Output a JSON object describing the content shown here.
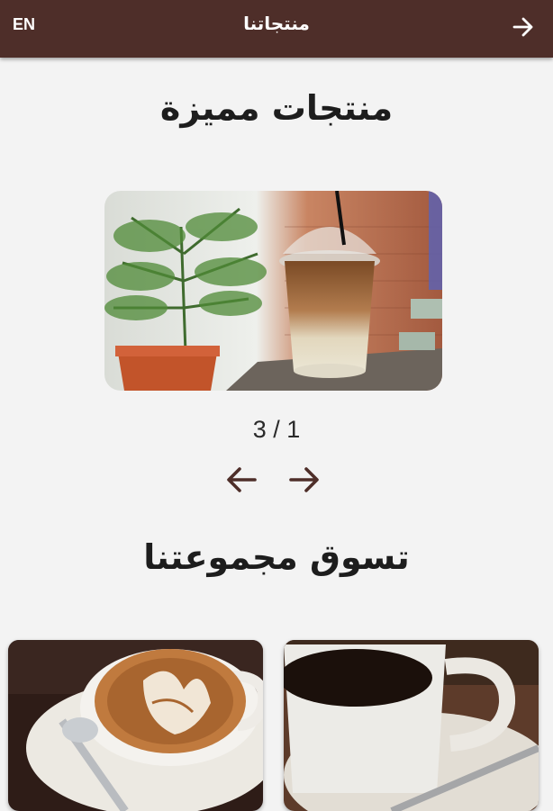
{
  "header": {
    "title": "منتجاتنا",
    "lang_toggle": "EN",
    "back_icon": "arrow-right-icon"
  },
  "featured": {
    "heading": "منتجات مميزة",
    "counter": "3 / 1",
    "prev_icon": "arrow-left-icon",
    "next_icon": "arrow-right-icon"
  },
  "collection": {
    "heading": "تسوق مجموعتنا"
  },
  "colors": {
    "header_bg": "#4e2e29",
    "accent": "#4e2e29",
    "page_bg": "#f3f3f3"
  }
}
